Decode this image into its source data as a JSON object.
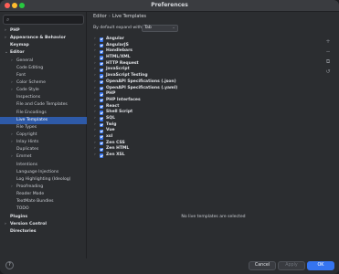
{
  "window": {
    "title": "Preferences"
  },
  "sidebar": {
    "search_placeholder": "",
    "items": [
      {
        "label": "PHP",
        "level": 0,
        "bold": true,
        "chevron": "›"
      },
      {
        "label": "Appearance & Behavior",
        "level": 0,
        "bold": true,
        "chevron": "›"
      },
      {
        "label": "Keymap",
        "level": 0,
        "bold": true,
        "chevron": ""
      },
      {
        "label": "Editor",
        "level": 0,
        "bold": true,
        "chevron": "⌄"
      },
      {
        "label": "General",
        "level": 1,
        "chevron": "›"
      },
      {
        "label": "Code Editing",
        "level": 1,
        "chevron": ""
      },
      {
        "label": "Font",
        "level": 1,
        "chevron": ""
      },
      {
        "label": "Color Scheme",
        "level": 1,
        "chevron": "›"
      },
      {
        "label": "Code Style",
        "level": 1,
        "chevron": "›"
      },
      {
        "label": "Inspections",
        "level": 1,
        "chevron": ""
      },
      {
        "label": "File and Code Templates",
        "level": 1,
        "chevron": ""
      },
      {
        "label": "File Encodings",
        "level": 1,
        "chevron": ""
      },
      {
        "label": "Live Templates",
        "level": 1,
        "chevron": "",
        "selected": true
      },
      {
        "label": "File Types",
        "level": 1,
        "chevron": ""
      },
      {
        "label": "Copyright",
        "level": 1,
        "chevron": "›"
      },
      {
        "label": "Inlay Hints",
        "level": 1,
        "chevron": "›"
      },
      {
        "label": "Duplicates",
        "level": 1,
        "chevron": ""
      },
      {
        "label": "Emmet",
        "level": 1,
        "chevron": "›"
      },
      {
        "label": "Intentions",
        "level": 1,
        "chevron": ""
      },
      {
        "label": "Language Injections",
        "level": 1,
        "chevron": ""
      },
      {
        "label": "Log Highlighting (Ideolog)",
        "level": 1,
        "chevron": ""
      },
      {
        "label": "Proofreading",
        "level": 1,
        "chevron": "›"
      },
      {
        "label": "Reader Mode",
        "level": 1,
        "chevron": ""
      },
      {
        "label": "TextMate Bundles",
        "level": 1,
        "chevron": ""
      },
      {
        "label": "TODO",
        "level": 1,
        "chevron": ""
      },
      {
        "label": "Plugins",
        "level": 0,
        "bold": true,
        "chevron": ""
      },
      {
        "label": "Version Control",
        "level": 0,
        "bold": true,
        "chevron": "›"
      },
      {
        "label": "Directories",
        "level": 0,
        "bold": true,
        "chevron": ""
      }
    ],
    "help_label": "?"
  },
  "content": {
    "breadcrumb_root": "Editor",
    "breadcrumb_sep": "›",
    "breadcrumb_current": "Live Templates",
    "expand_label": "By default expand with",
    "expand_value": "Tab",
    "templates": [
      "Angular",
      "AngularJS",
      "Handlebars",
      "HTML/XML",
      "HTTP Request",
      "JavaScript",
      "JavaScript Testing",
      "OpenAPI Specifications (.json)",
      "OpenAPI Specifications (.yaml)",
      "PHP",
      "PHP Interfaces",
      "React",
      "Shell Script",
      "SQL",
      "Twig",
      "Vue",
      "xsl",
      "Zen CSS",
      "Zen HTML",
      "Zen XSL"
    ],
    "empty_message": "No live templates are selected",
    "toolbar_icons": [
      "+",
      "−",
      "⧉",
      "↺"
    ]
  },
  "footer": {
    "cancel_label": "Cancel",
    "apply_label": "Apply",
    "ok_label": "OK"
  }
}
